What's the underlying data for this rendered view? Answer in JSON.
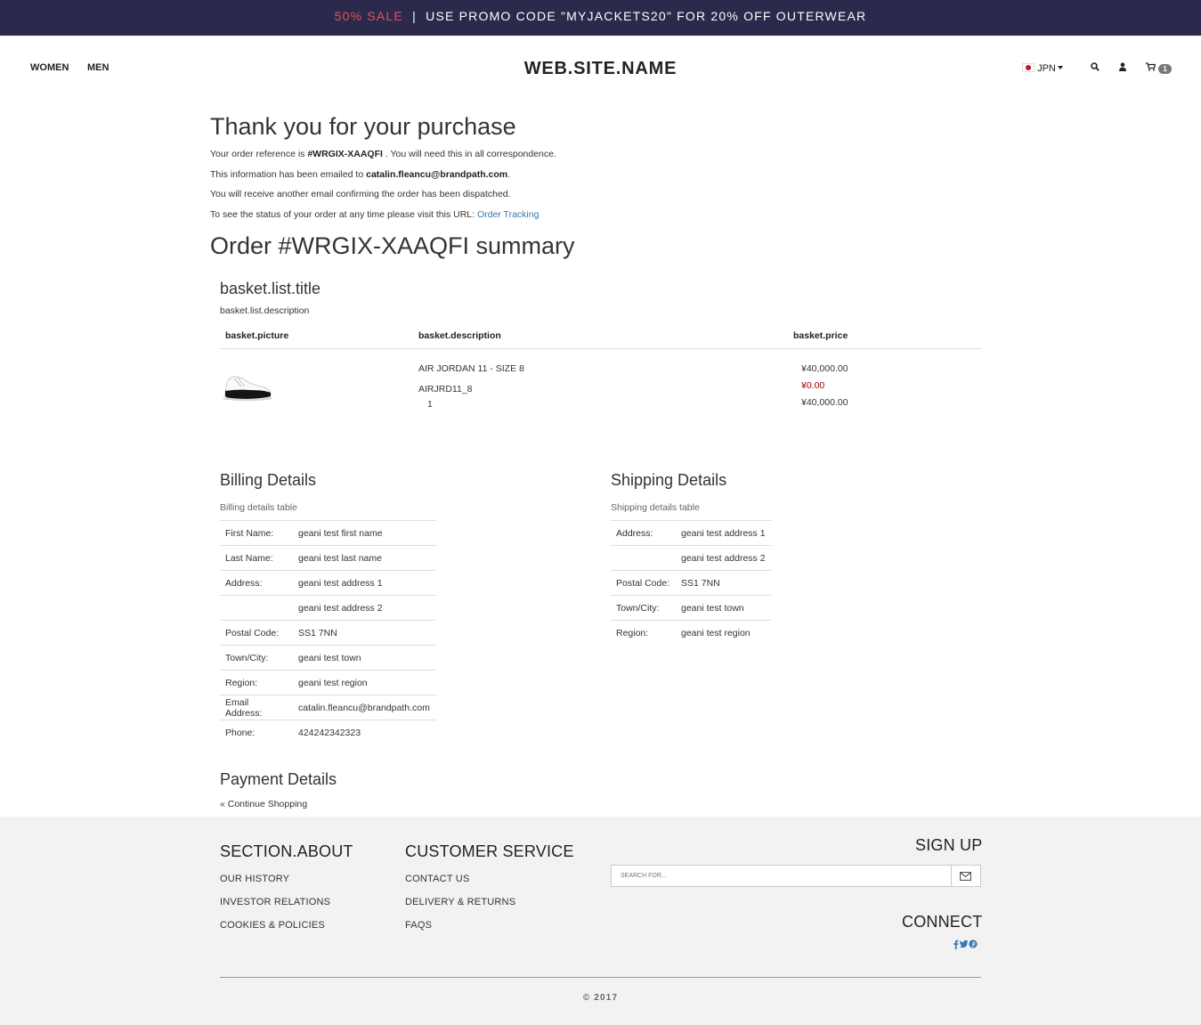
{
  "promo": {
    "sale": "50% SALE",
    "separator": "|",
    "message": "USE PROMO CODE \"MYJACKETS20\" FOR 20% OFF OUTERWEAR"
  },
  "nav": {
    "women": "WOMEN",
    "men": "MEN"
  },
  "brand": "WEB.SITE.NAME",
  "header_right": {
    "currency": "JPN",
    "cart_count": "1",
    "icons": [
      "search-icon",
      "user-icon",
      "cart-icon"
    ]
  },
  "confirmation": {
    "title": "Thank you for your purchase",
    "ref_prefix": "Your order reference is ",
    "ref": "#WRGIX-XAAQFI",
    "ref_suffix": " . You will need this in all correspondence.",
    "email_prefix": "This information has been emailed to ",
    "email": "catalin.fleancu@brandpath.com",
    "email_suffix": ".",
    "dispatch": "You will receive another email confirming the order has been dispatched.",
    "tracking_prefix": "To see the status of your order at any time please visit this URL: ",
    "tracking_link": "Order Tracking"
  },
  "summary_title": "Order #WRGIX-XAAQFI summary",
  "basket": {
    "title": "basket.list.title",
    "description": "basket.list.description",
    "headers": {
      "picture": "basket.picture",
      "description": "basket.description",
      "price": "basket.price"
    },
    "item": {
      "name": "AIR JORDAN 11 - SIZE 8",
      "sku": "AIRJRD11_8",
      "qty": "1",
      "price": "¥40,000.00",
      "discount": "¥0.00",
      "total": "¥40,000.00"
    }
  },
  "billing": {
    "title": "Billing Details",
    "caption": "Billing details table",
    "rows": [
      {
        "label": "First Name:",
        "value": "geani test first name"
      },
      {
        "label": "Last Name:",
        "value": "geani test last name"
      },
      {
        "label": "Address:",
        "value": "geani test address 1"
      },
      {
        "label": "",
        "value": "geani test address 2"
      },
      {
        "label": "Postal Code:",
        "value": "SS1 7NN"
      },
      {
        "label": "Town/City:",
        "value": "geani test town"
      },
      {
        "label": "Region:",
        "value": "geani test region"
      },
      {
        "label": "Email Address:",
        "value": "catalin.fleancu@brandpath.com"
      },
      {
        "label": "Phone:",
        "value": "424242342323"
      }
    ]
  },
  "shipping": {
    "title": "Shipping Details",
    "caption": "Shipping details table",
    "rows": [
      {
        "label": "Address:",
        "value": "geani test address 1"
      },
      {
        "label": "",
        "value": "geani test address 2"
      },
      {
        "label": "Postal Code:",
        "value": "SS1 7NN"
      },
      {
        "label": "Town/City:",
        "value": "geani test town"
      },
      {
        "label": "Region:",
        "value": "geani test region"
      }
    ]
  },
  "payment": {
    "title": "Payment Details",
    "continue": "« Continue Shopping"
  },
  "footer": {
    "about_title": "SECTION.ABOUT",
    "about_links": [
      "OUR HISTORY",
      "INVESTOR RELATIONS",
      "COOKIES & POLICIES"
    ],
    "service_title": "CUSTOMER SERVICE",
    "service_links": [
      "CONTACT US",
      "DELIVERY & RETURNS",
      "FAQS"
    ],
    "signup_title": "SIGN UP",
    "search_placeholder": "SEARCH FOR...",
    "connect_title": "CONNECT",
    "social_icons": [
      "facebook-icon",
      "twitter-icon",
      "pinterest-icon"
    ],
    "copyright": "© 2017"
  },
  "colors": {
    "promo_bg": "#2b2a4c",
    "sale": "#e8505b",
    "link": "#337ab7",
    "discount": "#aa0000",
    "footer_bg": "#f2f2f2"
  }
}
